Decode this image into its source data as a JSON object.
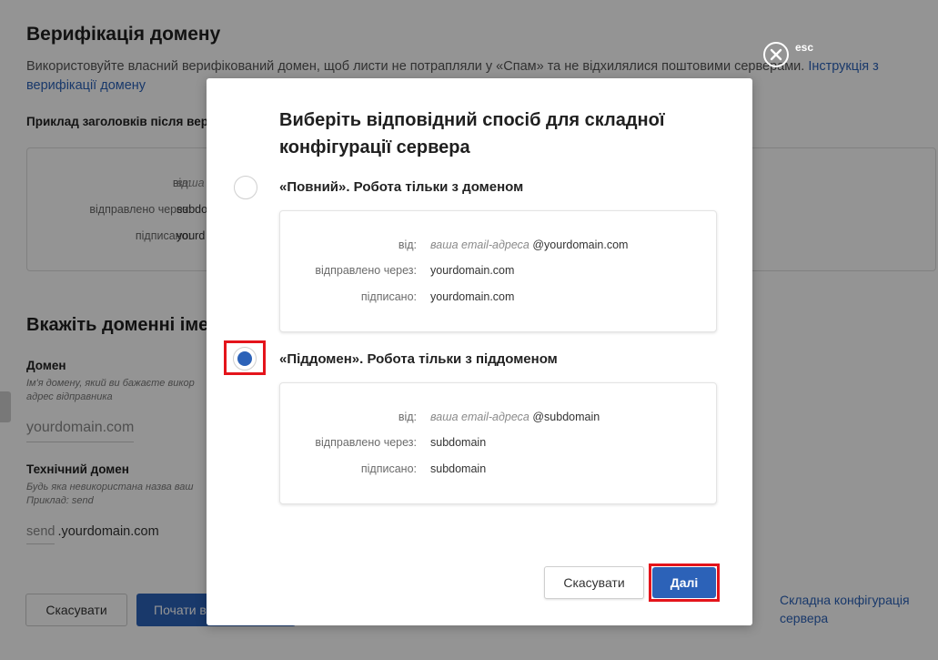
{
  "background": {
    "title": "Верифікація домену",
    "description": "Використовуйте власний верифікований домен, щоб листи не потрапляли у «Спам» та не відхилялися поштовими серверами.",
    "instructions_link": "Інструкція з верифікації домену",
    "example_heading": "Приклад заголовків після вер",
    "example": {
      "from_label": "від:",
      "from_value": "ваша",
      "sent_via_label": "відправлено через:",
      "sent_via_value": "subdo",
      "signed_label": "підписано:",
      "signed_value": "yourd"
    },
    "section_title": "Вкажіть доменні іме",
    "domain_label": "Домен",
    "domain_hint": "Ім'я домену, який ви бажаєте викор адрес відправника",
    "domain_value": "yourdomain.com",
    "tech_domain_label": "Технічний домен",
    "tech_domain_hint": "Будь яка невикористана назва ваш Приклад: send",
    "tech_prefix": "send",
    "tech_suffix": ".yourdomain.com",
    "cancel_label": "Скасувати",
    "start_label": "Почати в",
    "complex_config_link": "Складна конфігурація сервера"
  },
  "close": {
    "esc_label": "esc"
  },
  "modal": {
    "title": "Виберіть відповідний спосіб для складної конфігурації сервера",
    "options": [
      {
        "label": "«Повний». Робота тільки з доменом",
        "selected": false,
        "from_label": "від:",
        "from_placeholder": "ваша email-адреса",
        "from_domain": "@yourdomain.com",
        "sent_via_label": "відправлено через:",
        "sent_via_value": "yourdomain.com",
        "signed_label": "підписано:",
        "signed_value": "yourdomain.com"
      },
      {
        "label": "«Піддомен». Робота тільки з піддоменом",
        "selected": true,
        "from_label": "від:",
        "from_placeholder": "ваша email-адреса",
        "from_domain": "@subdomain",
        "sent_via_label": "відправлено через:",
        "sent_via_value": "subdomain",
        "signed_label": "підписано:",
        "signed_value": "subdomain"
      }
    ],
    "cancel_label": "Скасувати",
    "next_label": "Далі"
  },
  "colors": {
    "accent": "#2c62b8",
    "highlight": "#e4141b"
  }
}
